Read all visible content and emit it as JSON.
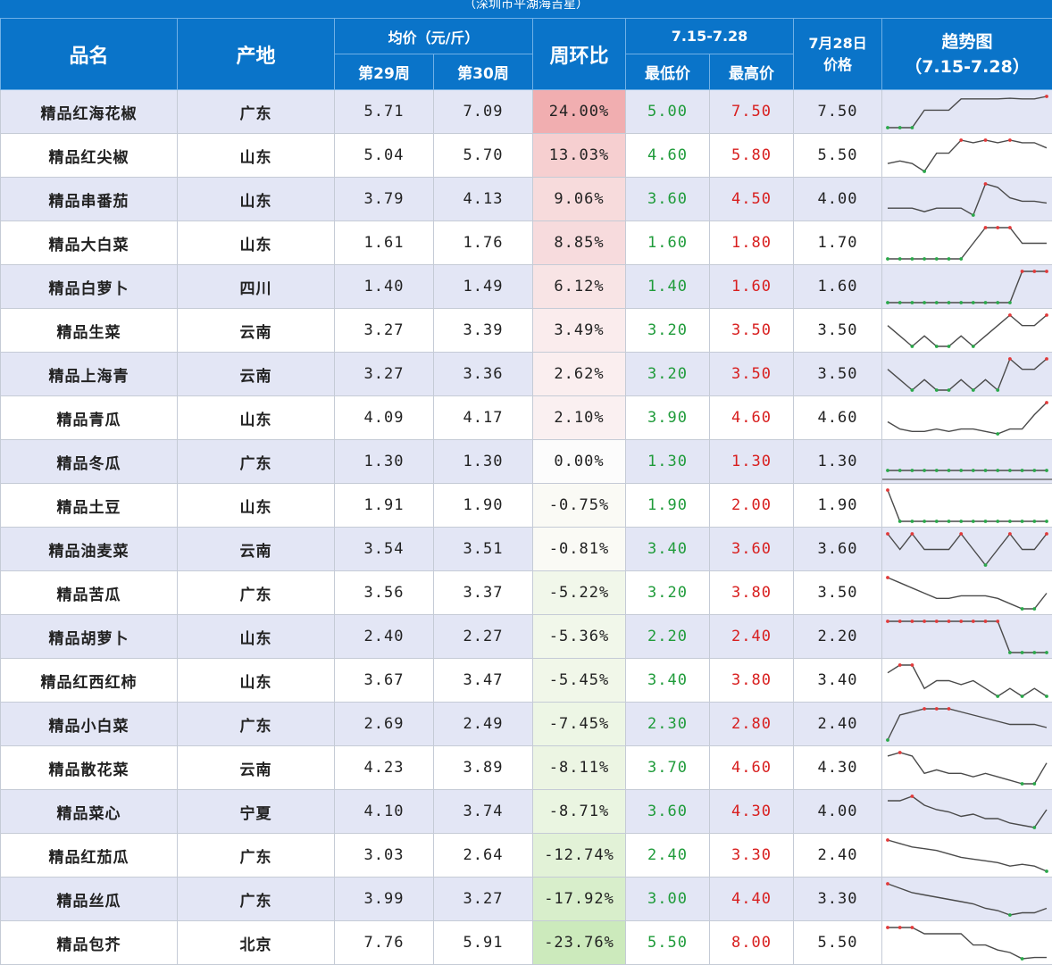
{
  "top_caption": "（深圳市平湖海吉星）",
  "headers": {
    "name": "品名",
    "origin": "产地",
    "avg_price": "均价（元/斤）",
    "week29": "第29周",
    "week30": "第30周",
    "wow": "周环比",
    "range": "7.15-7.28",
    "min": "最低价",
    "max": "最高价",
    "jul28_line1": "7月28日",
    "jul28_line2": "价格",
    "trend_line1": "趋势图",
    "trend_line2": "（7.15-7.28）"
  },
  "colors": {
    "header_bg": "#0a74c9",
    "odd_row_bg": "#e3e6f5",
    "min_price": "#1f9b3a",
    "max_price": "#d81e1e",
    "trend_high_marker": "#e23a3a",
    "trend_low_marker": "#2aa84a",
    "trend_line": "#4a4a4a"
  },
  "rows": [
    {
      "name": "精品红海花椒",
      "origin": "广东",
      "w29": "5.71",
      "w30": "7.09",
      "wow": "24.00%",
      "wow_value": 24.0,
      "min": "5.00",
      "max": "7.50",
      "jul28": "7.50",
      "trend": [
        5.0,
        5.0,
        5.0,
        6.4,
        6.4,
        6.4,
        7.3,
        7.3,
        7.3,
        7.3,
        7.35,
        7.3,
        7.3,
        7.5
      ]
    },
    {
      "name": "精品红尖椒",
      "origin": "山东",
      "w29": "5.04",
      "w30": "5.70",
      "wow": "13.03%",
      "wow_value": 13.03,
      "min": "4.60",
      "max": "5.80",
      "jul28": "5.50",
      "trend": [
        4.9,
        5.0,
        4.9,
        4.6,
        5.3,
        5.3,
        5.8,
        5.7,
        5.8,
        5.7,
        5.8,
        5.7,
        5.7,
        5.5
      ]
    },
    {
      "name": "精品串番茄",
      "origin": "山东",
      "w29": "3.79",
      "w30": "4.13",
      "wow": "9.06%",
      "wow_value": 9.06,
      "min": "3.60",
      "max": "4.50",
      "jul28": "4.00",
      "trend": [
        3.8,
        3.8,
        3.8,
        3.7,
        3.8,
        3.8,
        3.8,
        3.6,
        4.5,
        4.4,
        4.1,
        4.0,
        4.0,
        3.95
      ]
    },
    {
      "name": "精品大白菜",
      "origin": "山东",
      "w29": "1.61",
      "w30": "1.76",
      "wow": "8.85%",
      "wow_value": 8.85,
      "min": "1.60",
      "max": "1.80",
      "jul28": "1.70",
      "trend": [
        1.6,
        1.6,
        1.6,
        1.6,
        1.6,
        1.6,
        1.6,
        1.7,
        1.8,
        1.8,
        1.8,
        1.7,
        1.7,
        1.7
      ]
    },
    {
      "name": "精品白萝卜",
      "origin": "四川",
      "w29": "1.40",
      "w30": "1.49",
      "wow": "6.12%",
      "wow_value": 6.12,
      "min": "1.40",
      "max": "1.60",
      "jul28": "1.60",
      "trend": [
        1.4,
        1.4,
        1.4,
        1.4,
        1.4,
        1.4,
        1.4,
        1.4,
        1.4,
        1.4,
        1.4,
        1.6,
        1.6,
        1.6
      ]
    },
    {
      "name": "精品生菜",
      "origin": "云南",
      "w29": "3.27",
      "w30": "3.39",
      "wow": "3.49%",
      "wow_value": 3.49,
      "min": "3.20",
      "max": "3.50",
      "jul28": "3.50",
      "trend": [
        3.4,
        3.3,
        3.2,
        3.3,
        3.2,
        3.2,
        3.3,
        3.2,
        3.3,
        3.4,
        3.5,
        3.4,
        3.4,
        3.5
      ]
    },
    {
      "name": "精品上海青",
      "origin": "云南",
      "w29": "3.27",
      "w30": "3.36",
      "wow": "2.62%",
      "wow_value": 2.62,
      "min": "3.20",
      "max": "3.50",
      "jul28": "3.50",
      "trend": [
        3.4,
        3.3,
        3.2,
        3.3,
        3.2,
        3.2,
        3.3,
        3.2,
        3.3,
        3.2,
        3.5,
        3.4,
        3.4,
        3.5
      ]
    },
    {
      "name": "精品青瓜",
      "origin": "山东",
      "w29": "4.09",
      "w30": "4.17",
      "wow": "2.10%",
      "wow_value": 2.1,
      "min": "3.90",
      "max": "4.60",
      "jul28": "4.60",
      "trend": [
        4.2,
        4.05,
        4.0,
        4.0,
        4.05,
        4.0,
        4.05,
        4.05,
        4.0,
        3.95,
        4.05,
        4.05,
        4.35,
        4.6
      ]
    },
    {
      "name": "精品冬瓜",
      "origin": "广东",
      "w29": "1.30",
      "w30": "1.30",
      "wow": "0.00%",
      "wow_value": 0.0,
      "min": "1.30",
      "max": "1.30",
      "jul28": "1.30",
      "trend": [
        1.3,
        1.3,
        1.3,
        1.3,
        1.3,
        1.3,
        1.3,
        1.3,
        1.3,
        1.3,
        1.3,
        1.3,
        1.3,
        1.3
      ]
    },
    {
      "name": "精品土豆",
      "origin": "山东",
      "w29": "1.91",
      "w30": "1.90",
      "wow": "-0.75%",
      "wow_value": -0.75,
      "min": "1.90",
      "max": "2.00",
      "jul28": "1.90",
      "trend": [
        2.0,
        1.9,
        1.9,
        1.9,
        1.9,
        1.9,
        1.9,
        1.9,
        1.9,
        1.9,
        1.9,
        1.9,
        1.9,
        1.9
      ]
    },
    {
      "name": "精品油麦菜",
      "origin": "云南",
      "w29": "3.54",
      "w30": "3.51",
      "wow": "-0.81%",
      "wow_value": -0.81,
      "min": "3.40",
      "max": "3.60",
      "jul28": "3.60",
      "trend": [
        3.6,
        3.5,
        3.6,
        3.5,
        3.5,
        3.5,
        3.6,
        3.5,
        3.4,
        3.5,
        3.6,
        3.5,
        3.5,
        3.6
      ]
    },
    {
      "name": "精品苦瓜",
      "origin": "广东",
      "w29": "3.56",
      "w30": "3.37",
      "wow": "-5.22%",
      "wow_value": -5.22,
      "min": "3.20",
      "max": "3.80",
      "jul28": "3.50",
      "trend": [
        3.8,
        3.7,
        3.6,
        3.5,
        3.4,
        3.4,
        3.45,
        3.45,
        3.45,
        3.4,
        3.3,
        3.2,
        3.2,
        3.5
      ]
    },
    {
      "name": "精品胡萝卜",
      "origin": "山东",
      "w29": "2.40",
      "w30": "2.27",
      "wow": "-5.36%",
      "wow_value": -5.36,
      "min": "2.20",
      "max": "2.40",
      "jul28": "2.20",
      "trend": [
        2.4,
        2.4,
        2.4,
        2.4,
        2.4,
        2.4,
        2.4,
        2.4,
        2.4,
        2.4,
        2.2,
        2.2,
        2.2,
        2.2
      ]
    },
    {
      "name": "精品红西红柿",
      "origin": "山东",
      "w29": "3.67",
      "w30": "3.47",
      "wow": "-5.45%",
      "wow_value": -5.45,
      "min": "3.40",
      "max": "3.80",
      "jul28": "3.40",
      "trend": [
        3.7,
        3.8,
        3.8,
        3.5,
        3.6,
        3.6,
        3.55,
        3.6,
        3.5,
        3.4,
        3.5,
        3.4,
        3.5,
        3.4
      ]
    },
    {
      "name": "精品小白菜",
      "origin": "广东",
      "w29": "2.69",
      "w30": "2.49",
      "wow": "-7.45%",
      "wow_value": -7.45,
      "min": "2.30",
      "max": "2.80",
      "jul28": "2.40",
      "trend": [
        2.3,
        2.7,
        2.75,
        2.8,
        2.8,
        2.8,
        2.75,
        2.7,
        2.65,
        2.6,
        2.55,
        2.55,
        2.55,
        2.5
      ]
    },
    {
      "name": "精品散花菜",
      "origin": "云南",
      "w29": "4.23",
      "w30": "3.89",
      "wow": "-8.11%",
      "wow_value": -8.11,
      "min": "3.70",
      "max": "4.60",
      "jul28": "4.30",
      "trend": [
        4.5,
        4.6,
        4.5,
        4.0,
        4.1,
        4.0,
        4.0,
        3.9,
        4.0,
        3.9,
        3.8,
        3.7,
        3.7,
        4.3
      ]
    },
    {
      "name": "精品菜心",
      "origin": "宁夏",
      "w29": "4.10",
      "w30": "3.74",
      "wow": "-8.71%",
      "wow_value": -8.71,
      "min": "3.60",
      "max": "4.30",
      "jul28": "4.00",
      "trend": [
        4.2,
        4.2,
        4.3,
        4.1,
        4.0,
        3.95,
        3.85,
        3.9,
        3.8,
        3.8,
        3.7,
        3.65,
        3.6,
        4.0
      ]
    },
    {
      "name": "精品红茄瓜",
      "origin": "广东",
      "w29": "3.03",
      "w30": "2.64",
      "wow": "-12.74%",
      "wow_value": -12.74,
      "min": "2.40",
      "max": "3.30",
      "jul28": "2.40",
      "trend": [
        3.3,
        3.2,
        3.1,
        3.05,
        3.0,
        2.9,
        2.8,
        2.75,
        2.7,
        2.65,
        2.55,
        2.6,
        2.55,
        2.4
      ]
    },
    {
      "name": "精品丝瓜",
      "origin": "广东",
      "w29": "3.99",
      "w30": "3.27",
      "wow": "-17.92%",
      "wow_value": -17.92,
      "min": "3.00",
      "max": "4.40",
      "jul28": "3.30",
      "trend": [
        4.4,
        4.2,
        4.0,
        3.9,
        3.8,
        3.7,
        3.6,
        3.5,
        3.3,
        3.2,
        3.0,
        3.1,
        3.1,
        3.3
      ]
    },
    {
      "name": "精品包芥",
      "origin": "北京",
      "w29": "7.76",
      "w30": "5.91",
      "wow": "-23.76%",
      "wow_value": -23.76,
      "min": "5.50",
      "max": "8.00",
      "jul28": "5.50",
      "trend": [
        8.0,
        8.0,
        8.0,
        7.5,
        7.5,
        7.5,
        7.5,
        6.6,
        6.6,
        6.2,
        6.0,
        5.5,
        5.6,
        5.6
      ]
    }
  ]
}
